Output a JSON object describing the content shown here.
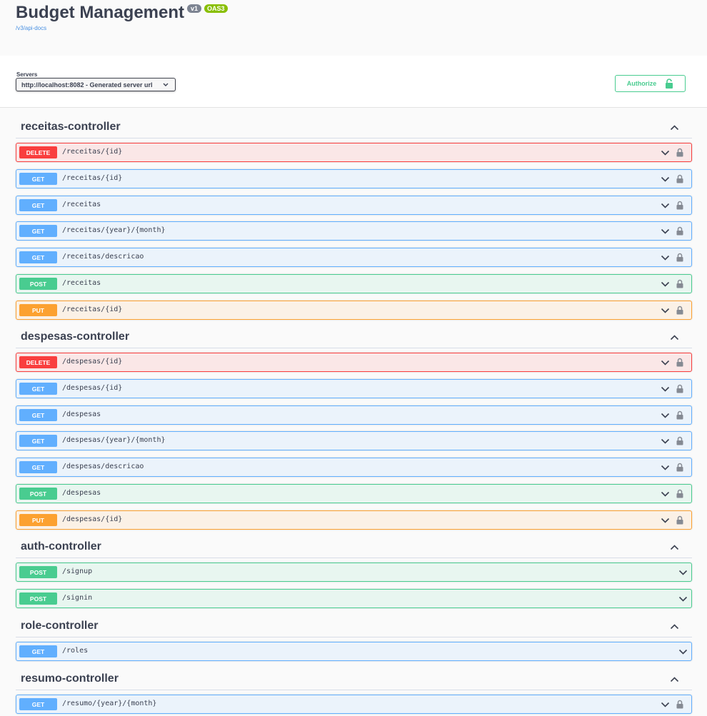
{
  "info": {
    "title": "Budget Management",
    "version": "v1",
    "oas": "OAS3",
    "docs_link": "/v3/api-docs"
  },
  "scheme": {
    "servers_label": "Servers",
    "server_selected": "http://localhost:8082 - Generated server url",
    "authorize_label": "Authorize"
  },
  "colors": {
    "delete": "#f93e3e",
    "get": "#61affe",
    "post": "#49cc90",
    "put": "#fca130"
  },
  "tags": [
    {
      "name": "receitas-controller",
      "operations": [
        {
          "method": "DELETE",
          "path": "/receitas/{id}",
          "locked": true
        },
        {
          "method": "GET",
          "path": "/receitas/{id}",
          "locked": true
        },
        {
          "method": "GET",
          "path": "/receitas",
          "locked": true
        },
        {
          "method": "GET",
          "path": "/receitas/{year}/{month}",
          "locked": true
        },
        {
          "method": "GET",
          "path": "/receitas/descricao",
          "locked": true
        },
        {
          "method": "POST",
          "path": "/receitas",
          "locked": true
        },
        {
          "method": "PUT",
          "path": "/receitas/{id}",
          "locked": true
        }
      ]
    },
    {
      "name": "despesas-controller",
      "operations": [
        {
          "method": "DELETE",
          "path": "/despesas/{id}",
          "locked": true
        },
        {
          "method": "GET",
          "path": "/despesas/{id}",
          "locked": true
        },
        {
          "method": "GET",
          "path": "/despesas",
          "locked": true
        },
        {
          "method": "GET",
          "path": "/despesas/{year}/{month}",
          "locked": true
        },
        {
          "method": "GET",
          "path": "/despesas/descricao",
          "locked": true
        },
        {
          "method": "POST",
          "path": "/despesas",
          "locked": true
        },
        {
          "method": "PUT",
          "path": "/despesas/{id}",
          "locked": true
        }
      ]
    },
    {
      "name": "auth-controller",
      "operations": [
        {
          "method": "POST",
          "path": "/signup",
          "locked": false
        },
        {
          "method": "POST",
          "path": "/signin",
          "locked": false
        }
      ]
    },
    {
      "name": "role-controller",
      "operations": [
        {
          "method": "GET",
          "path": "/roles",
          "locked": false
        }
      ]
    },
    {
      "name": "resumo-controller",
      "operations": [
        {
          "method": "GET",
          "path": "/resumo/{year}/{month}",
          "locked": true
        }
      ]
    }
  ]
}
